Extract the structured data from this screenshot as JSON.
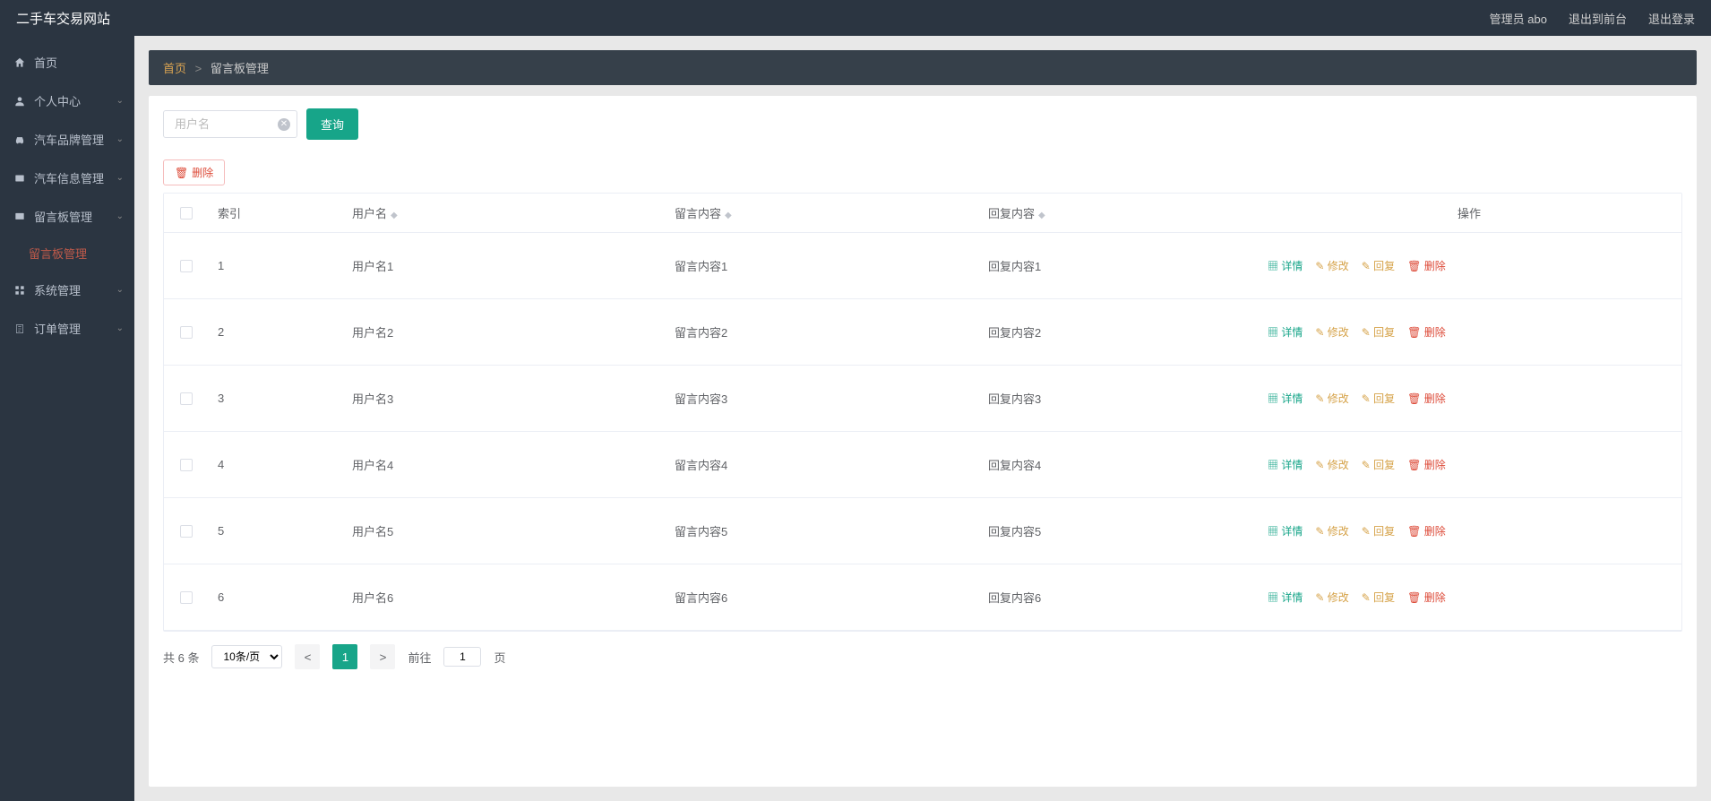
{
  "topbar": {
    "brand": "二手车交易网站",
    "admin_label": "管理员 abo",
    "to_front": "退出到前台",
    "logout": "退出登录"
  },
  "sidebar": {
    "items": [
      {
        "label": "首页",
        "has_sub": false
      },
      {
        "label": "个人中心",
        "has_sub": true
      },
      {
        "label": "汽车品牌管理",
        "has_sub": true
      },
      {
        "label": "汽车信息管理",
        "has_sub": true
      },
      {
        "label": "留言板管理",
        "has_sub": true,
        "sub": "留言板管理",
        "active": true
      },
      {
        "label": "系统管理",
        "has_sub": true
      },
      {
        "label": "订单管理",
        "has_sub": true
      }
    ]
  },
  "breadcrumb": {
    "home": "首页",
    "current": "留言板管理"
  },
  "toolbar": {
    "search_placeholder": "用户名",
    "query_label": "查询",
    "batch_delete_label": "删除"
  },
  "table": {
    "headers": {
      "index": "索引",
      "user": "用户名",
      "msg": "留言内容",
      "reply": "回复内容",
      "op": "操作"
    },
    "rows": [
      {
        "index": "1",
        "user": "用户名1",
        "msg": "留言内容1",
        "reply": "回复内容1"
      },
      {
        "index": "2",
        "user": "用户名2",
        "msg": "留言内容2",
        "reply": "回复内容2"
      },
      {
        "index": "3",
        "user": "用户名3",
        "msg": "留言内容3",
        "reply": "回复内容3"
      },
      {
        "index": "4",
        "user": "用户名4",
        "msg": "留言内容4",
        "reply": "回复内容4"
      },
      {
        "index": "5",
        "user": "用户名5",
        "msg": "留言内容5",
        "reply": "回复内容5"
      },
      {
        "index": "6",
        "user": "用户名6",
        "msg": "留言内容6",
        "reply": "回复内容6"
      }
    ],
    "ops": {
      "detail": "详情",
      "edit": "修改",
      "reply": "回复",
      "delete": "删除"
    }
  },
  "pager": {
    "total_label": "共 6 条",
    "page_size": "10条/页",
    "current_page": "1",
    "goto_prefix": "前往",
    "goto_suffix": "页",
    "goto_value": "1"
  }
}
